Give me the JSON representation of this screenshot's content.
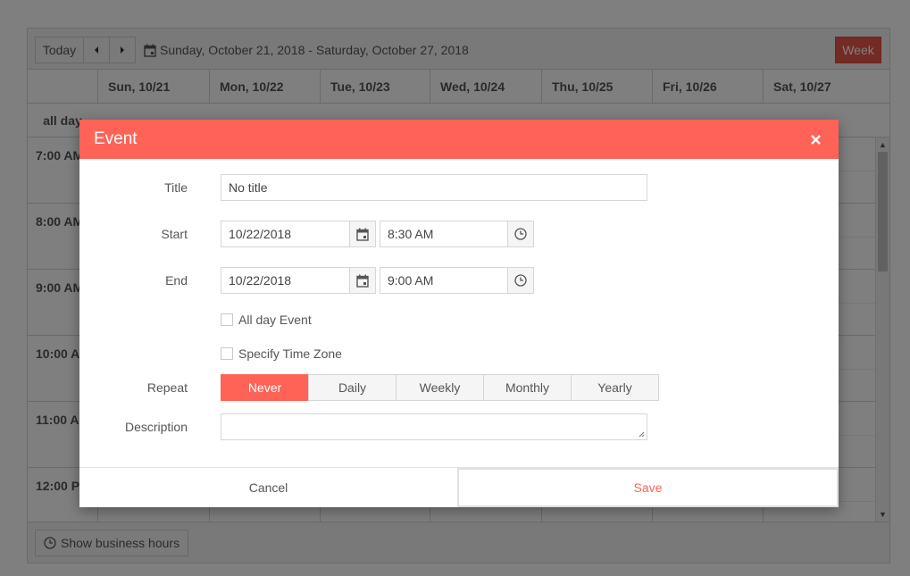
{
  "toolbar": {
    "today_label": "Today",
    "date_range": "Sunday, October 21, 2018 - Saturday, October 27, 2018",
    "view_label": "Week"
  },
  "days": [
    "Sun, 10/21",
    "Mon, 10/22",
    "Tue, 10/23",
    "Wed, 10/24",
    "Thu, 10/25",
    "Fri, 10/26",
    "Sat, 10/27"
  ],
  "allday_label": "all day",
  "times": [
    "7:00 AM",
    "8:00 AM",
    "9:00 AM",
    "10:00 AM",
    "11:00 AM",
    "12:00 PM"
  ],
  "footer": {
    "business_hours_label": "Show business hours"
  },
  "dialog": {
    "title": "Event",
    "title_label": "Title",
    "title_value": "No title",
    "start_label": "Start",
    "start_date": "10/22/2018",
    "start_time": "8:30 AM",
    "end_label": "End",
    "end_date": "10/22/2018",
    "end_time": "9:00 AM",
    "allday_event_label": "All day Event",
    "timezone_label": "Specify Time Zone",
    "repeat_label": "Repeat",
    "repeat_options": [
      "Never",
      "Daily",
      "Weekly",
      "Monthly",
      "Yearly"
    ],
    "repeat_selected": "Never",
    "description_label": "Description",
    "description_value": "",
    "cancel_label": "Cancel",
    "save_label": "Save"
  },
  "colors": {
    "accent": "#ff6358",
    "week_button": "#e8574b"
  }
}
